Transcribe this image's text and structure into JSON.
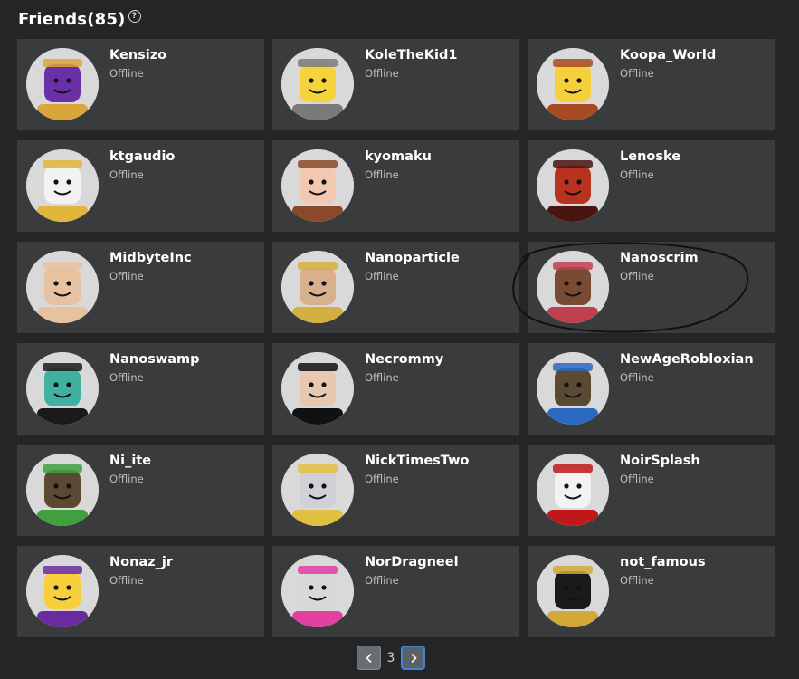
{
  "header": {
    "title": "Friends(85)",
    "help_icon": "question-circle-icon"
  },
  "friends": [
    {
      "name": "Kensizo",
      "status": "Offline",
      "skin": "#6b2fa8",
      "accent": "#d9a63a"
    },
    {
      "name": "KoleTheKid1",
      "status": "Offline",
      "skin": "#f5d33c",
      "accent": "#7a7a7a"
    },
    {
      "name": "Koopa_World",
      "status": "Offline",
      "skin": "#f5cf3c",
      "accent": "#a84a22"
    },
    {
      "name": "ktgaudio",
      "status": "Offline",
      "skin": "#f2f2f2",
      "accent": "#e0b53c"
    },
    {
      "name": "kyomaku",
      "status": "Offline",
      "skin": "#f2c8b0",
      "accent": "#8a4a2a"
    },
    {
      "name": "Lenoske",
      "status": "Offline",
      "skin": "#b8331f",
      "accent": "#4a1410"
    },
    {
      "name": "MidbyteInc",
      "status": "Offline",
      "skin": "#e6c2a0",
      "accent": "#e6c2a0"
    },
    {
      "name": "Nanoparticle",
      "status": "Offline",
      "skin": "#d9b08c",
      "accent": "#d4b040"
    },
    {
      "name": "Nanoscrim",
      "status": "Offline",
      "skin": "#7a4a32",
      "accent": "#c04050"
    },
    {
      "name": "Nanoswamp",
      "status": "Offline",
      "skin": "#40b0a0",
      "accent": "#1a1a1a"
    },
    {
      "name": "Necrommy",
      "status": "Offline",
      "skin": "#e8c8b0",
      "accent": "#111111"
    },
    {
      "name": "NewAgeRobloxian",
      "status": "Offline",
      "skin": "#5a4a32",
      "accent": "#2a6ac0"
    },
    {
      "name": "Ni_ite",
      "status": "Offline",
      "skin": "#5a4a32",
      "accent": "#40a040"
    },
    {
      "name": "NickTimesTwo",
      "status": "Offline",
      "skin": "#d0d0d8",
      "accent": "#e0c040"
    },
    {
      "name": "NoirSplash",
      "status": "Offline",
      "skin": "#f2f2f2",
      "accent": "#c01818"
    },
    {
      "name": "Nonaz_jr",
      "status": "Offline",
      "skin": "#f5cf3c",
      "accent": "#6a2aa0"
    },
    {
      "name": "NorDragneel",
      "status": "Offline",
      "skin": "#d8d8d8",
      "accent": "#e040a0"
    },
    {
      "name": "not_famous",
      "status": "Offline",
      "skin": "#1a1a1a",
      "accent": "#d4a838"
    }
  ],
  "pagination": {
    "current_page": "3",
    "prev_icon": "chevron-left-icon",
    "next_icon": "chevron-right-icon"
  }
}
